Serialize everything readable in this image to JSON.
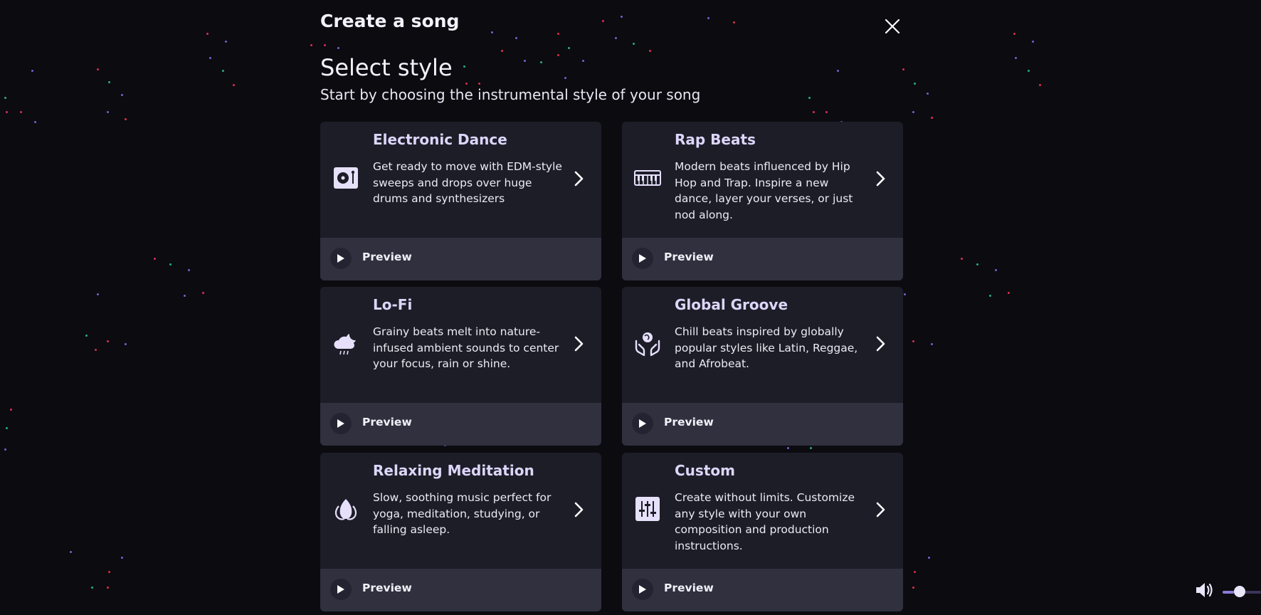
{
  "header": {
    "title": "Create a song"
  },
  "section": {
    "title": "Select style",
    "subtitle": "Start by choosing the instrumental style of your song"
  },
  "styles": [
    {
      "title": "Electronic Dance",
      "description": "Get ready to move with EDM-style sweeps and drops over huge drums and synthesizers",
      "icon": "turntable-icon",
      "preview_label": "Preview"
    },
    {
      "title": "Rap Beats",
      "description": "Modern beats influenced by Hip Hop and Trap. Inspire a new dance, layer your verses, or just nod along.",
      "icon": "keyboard-icon",
      "preview_label": "Preview"
    },
    {
      "title": "Lo-Fi",
      "description": "Grainy beats melt into nature-infused ambient sounds to center your focus, rain or shine.",
      "icon": "cloud-rain-icon",
      "preview_label": "Preview"
    },
    {
      "title": "Global Groove",
      "description": "Chill beats inspired by globally popular styles like Latin, Reggae, and Afrobeat.",
      "icon": "globe-hands-icon",
      "preview_label": "Preview"
    },
    {
      "title": "Relaxing Meditation",
      "description": "Slow, soothing music perfect for yoga, meditation, studying, or falling asleep.",
      "icon": "lotus-icon",
      "preview_label": "Preview"
    },
    {
      "title": "Custom",
      "description": "Create without limits. Customize any style with your own composition and production instructions.",
      "icon": "sliders-icon",
      "preview_label": "Preview"
    }
  ],
  "volume": {
    "level": 0.3
  },
  "colors": {
    "background": "#0b0b10",
    "card": "#1d1d27",
    "card_footer": "#30303f",
    "card_title": "#ddd6fb",
    "accent": "#8c7ad8"
  }
}
